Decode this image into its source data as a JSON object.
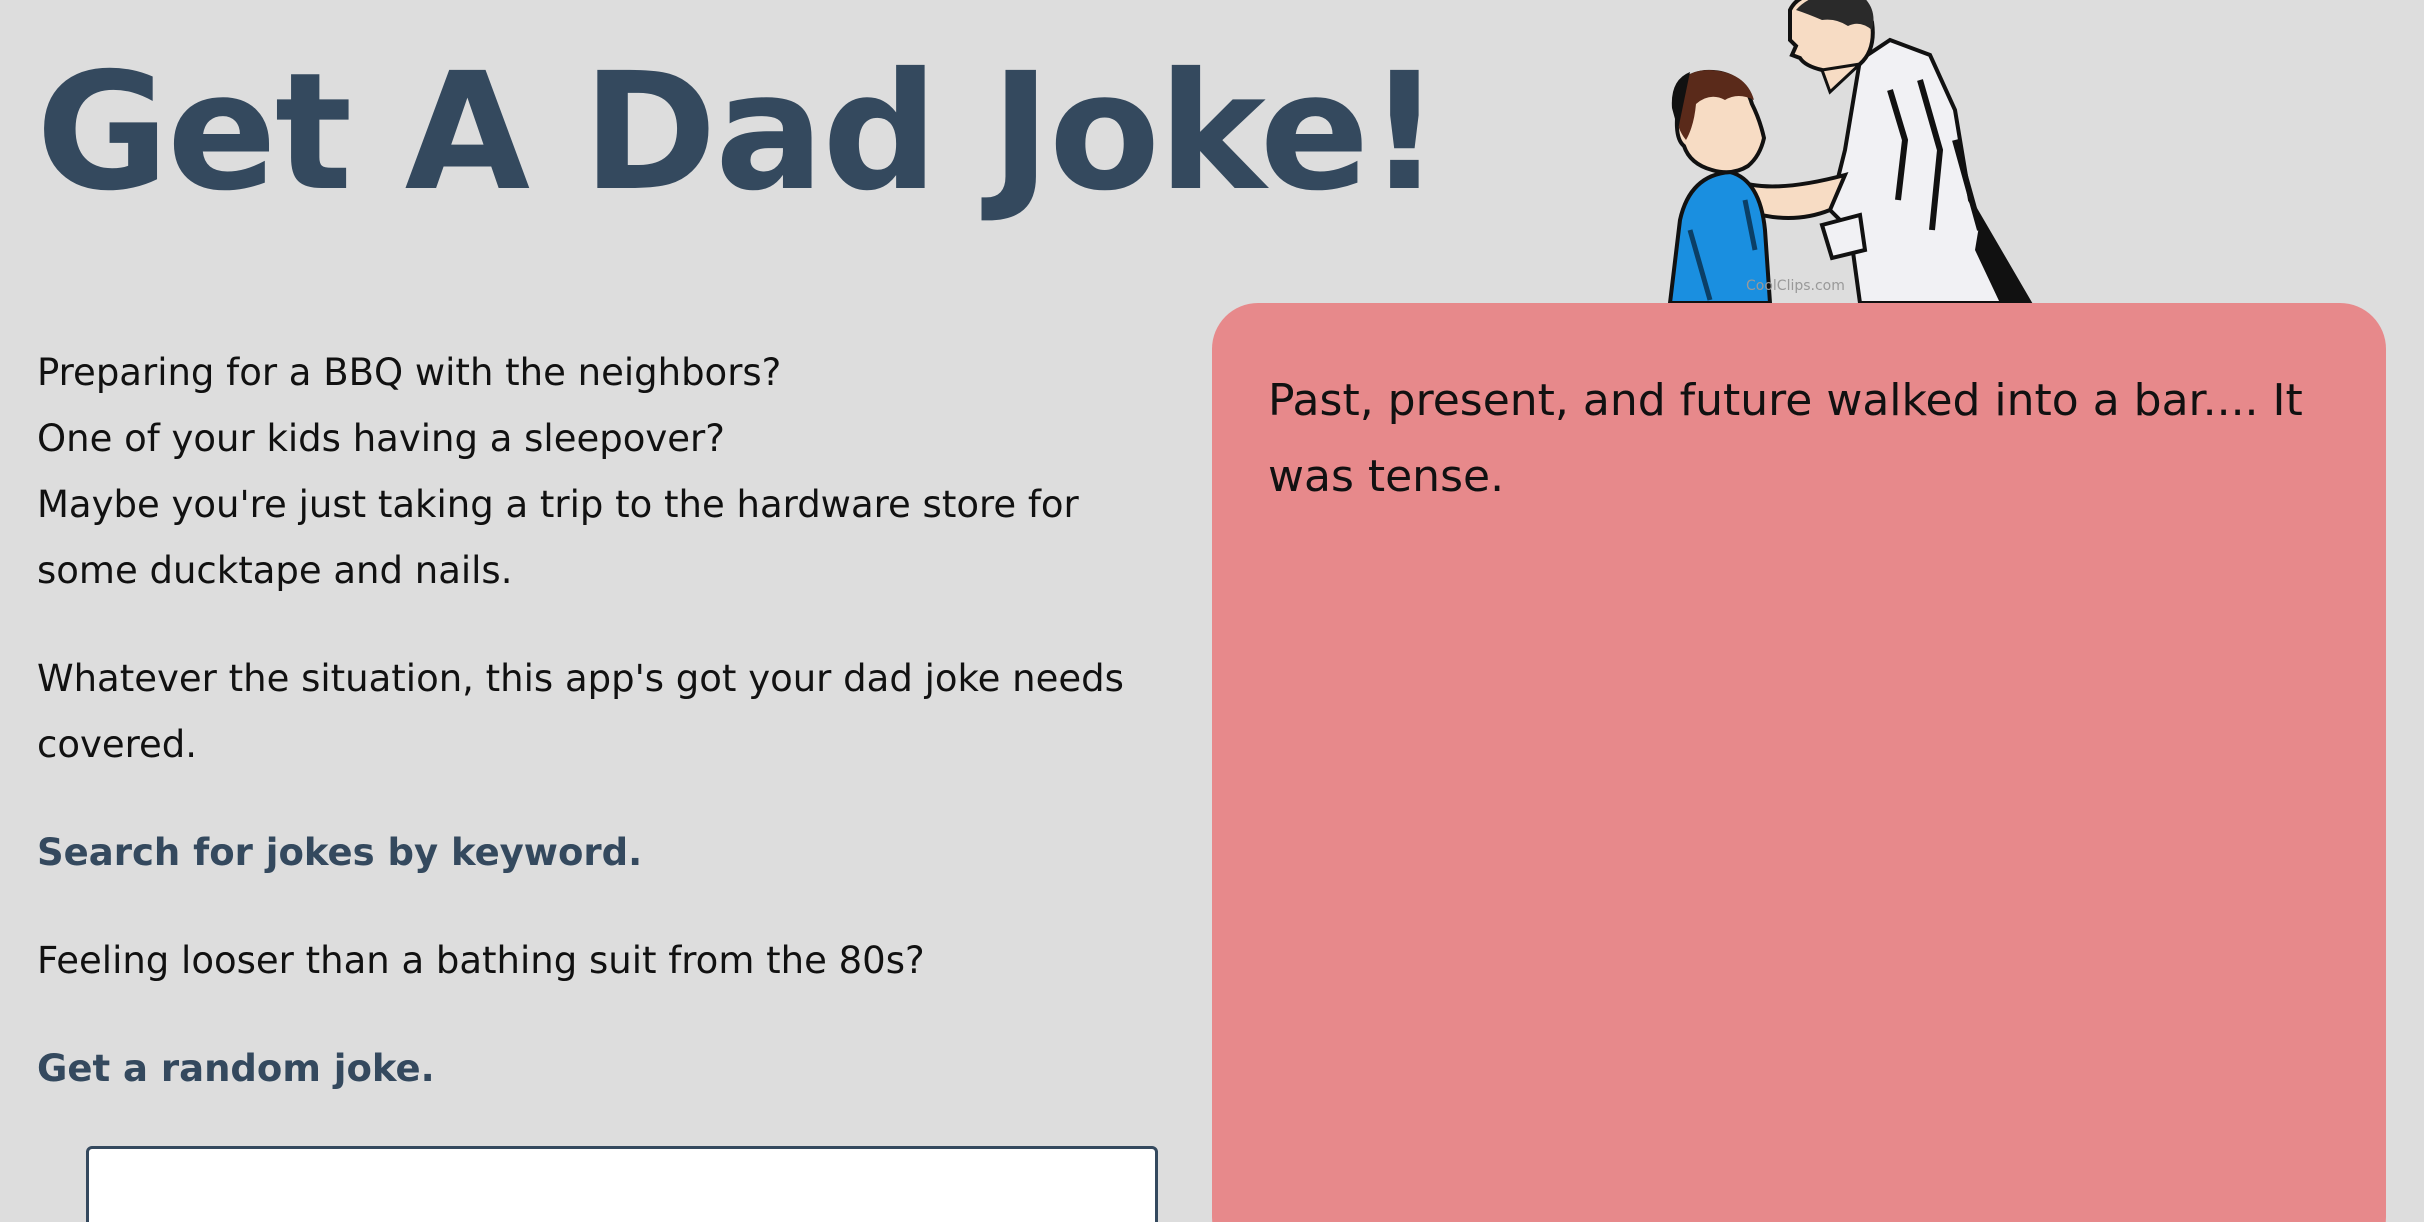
{
  "page": {
    "title": "Get A Dad Joke!"
  },
  "intro": {
    "lines": [
      "Preparing for a BBQ with the neighbors?",
      "One of your kids having a sleepover?",
      "Maybe you're just taking a trip to the hardware store for some ducktape and nails."
    ],
    "situation": "Whatever the situation, this app's got your dad joke needs covered."
  },
  "links": {
    "search": "Search for jokes by keyword.",
    "random": "Get a random joke."
  },
  "loose_text": "Feeling looser than a bathing suit from the 80s?",
  "search_input": {
    "value": "",
    "placeholder": ""
  },
  "joke": {
    "text": "Past, present, and future walked into a bar.... It was tense."
  },
  "illustration": {
    "watermark": "CoolClips.com"
  },
  "colors": {
    "background": "#dddddd",
    "title": "#34495e",
    "link": "#34495e",
    "joke_panel": "#e7898b",
    "boy_shirt": "#1a8fe0"
  }
}
